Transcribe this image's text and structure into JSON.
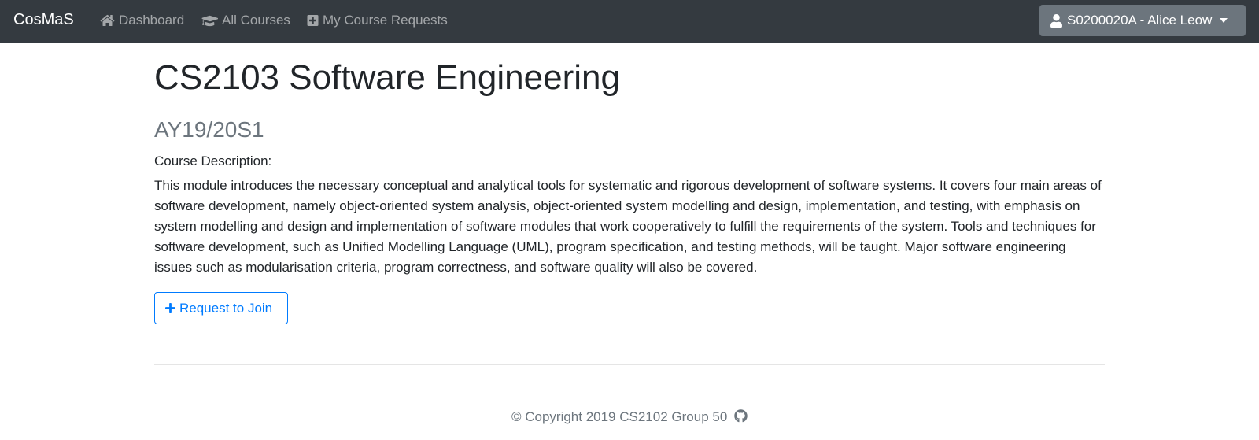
{
  "navbar": {
    "brand": "CosMaS",
    "links": [
      {
        "label": "Dashboard",
        "icon": "home-icon"
      },
      {
        "label": "All Courses",
        "icon": "graduation-cap-icon"
      },
      {
        "label": "My Course Requests",
        "icon": "plus-square-icon"
      }
    ],
    "user_menu": {
      "label": "S0200020A - Alice Leow",
      "icon": "user-icon"
    }
  },
  "course": {
    "title": "CS2103 Software Engineering",
    "semester": "AY19/20S1",
    "description_label": "Course Description:",
    "description": "This module introduces the necessary conceptual and analytical tools for systematic and rigorous development of software systems. It covers four main areas of software development, namely object-oriented system analysis, object-oriented system modelling and design, implementation, and testing, with emphasis on system modelling and design and implementation of software modules that work cooperatively to fulfill the requirements of the system. Tools and techniques for software development, such as Unified Modelling Language (UML), program specification, and testing methods, will be taught. Major software engineering issues such as modularisation criteria, program correctness, and software quality will also be covered.",
    "join_button": "Request to Join"
  },
  "footer": {
    "copyright": "© Copyright 2019 CS2102 Group 50",
    "icon": "github-icon"
  },
  "colors": {
    "navbar_bg": "#343a40",
    "user_button_bg": "#6c757d",
    "primary": "#007bff",
    "muted": "#6c757d"
  }
}
